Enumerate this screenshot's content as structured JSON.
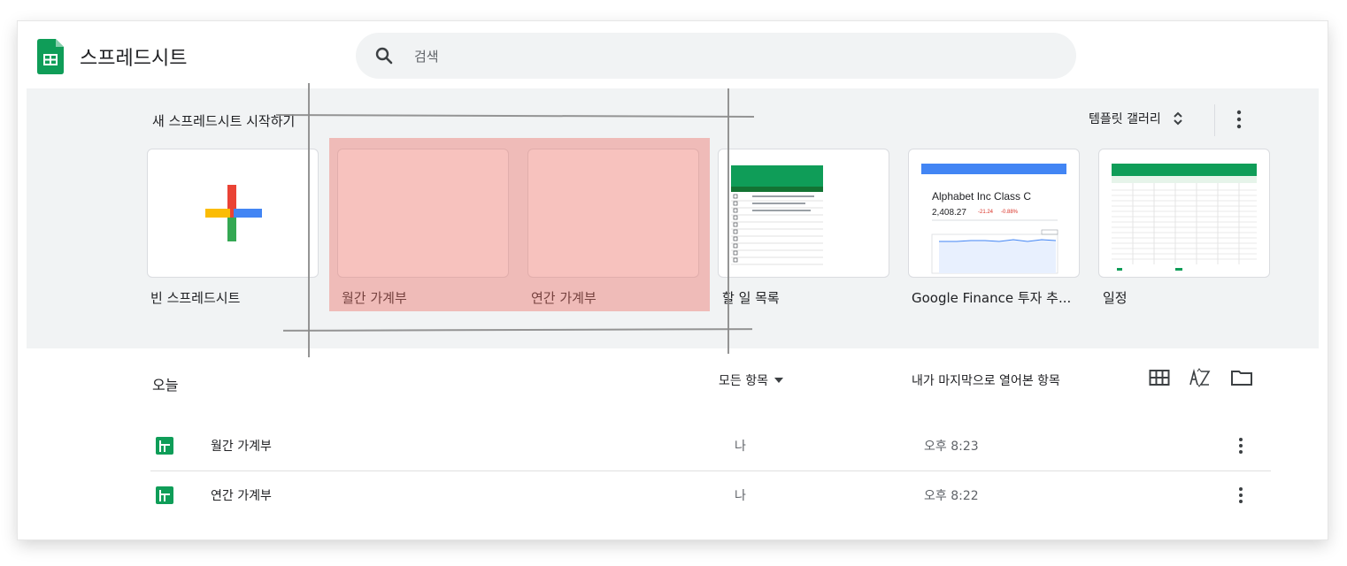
{
  "app": {
    "title": "스프레드시트"
  },
  "search": {
    "placeholder": "검색"
  },
  "templates": {
    "heading": "새 스프레드시트 시작하기",
    "gallery_label": "템플릿 갤러리",
    "items": [
      {
        "label": "빈 스프레드시트"
      },
      {
        "label": "월간 가계부"
      },
      {
        "label": "연간 가계부"
      },
      {
        "label": "할 일 목록"
      },
      {
        "label": "Google Finance 투자 추..."
      },
      {
        "label": "일정"
      }
    ],
    "finance_preview": {
      "title": "Alphabet Inc Class C",
      "price": "2,408.27",
      "change": "-21.24",
      "change_pct": "-0.88%"
    }
  },
  "list": {
    "section_label": "오늘",
    "owner_filter": "모든 항목",
    "sort_label": "내가 마지막으로 열어본 항목",
    "rows": [
      {
        "name": "월간 가계부",
        "owner": "나",
        "time": "오후 8:23"
      },
      {
        "name": "연간 가계부",
        "owner": "나",
        "time": "오후 8:22"
      }
    ]
  },
  "colors": {
    "sheets_green": "#0f9d58",
    "highlight": "#eb6e64",
    "band_bg": "#f1f3f4"
  }
}
